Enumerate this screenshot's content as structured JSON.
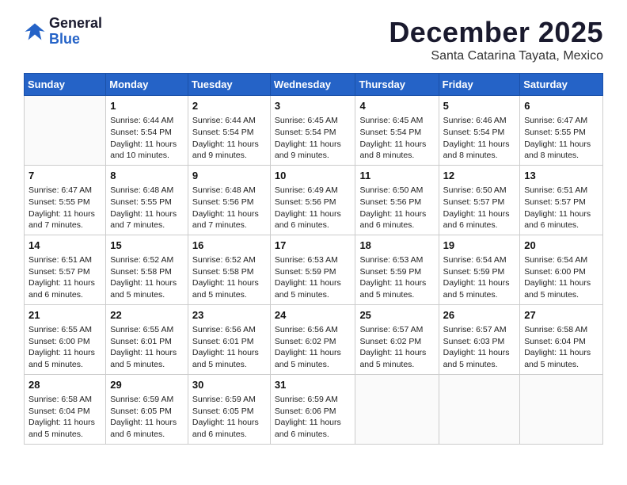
{
  "logo": {
    "line1": "General",
    "line2": "Blue"
  },
  "header": {
    "title": "December 2025",
    "subtitle": "Santa Catarina Tayata, Mexico"
  },
  "weekdays": [
    "Sunday",
    "Monday",
    "Tuesday",
    "Wednesday",
    "Thursday",
    "Friday",
    "Saturday"
  ],
  "weeks": [
    [
      {
        "day": "",
        "empty": true
      },
      {
        "day": "1",
        "sunrise": "6:44 AM",
        "sunset": "5:54 PM",
        "daylight": "11 hours and 10 minutes."
      },
      {
        "day": "2",
        "sunrise": "6:44 AM",
        "sunset": "5:54 PM",
        "daylight": "11 hours and 9 minutes."
      },
      {
        "day": "3",
        "sunrise": "6:45 AM",
        "sunset": "5:54 PM",
        "daylight": "11 hours and 9 minutes."
      },
      {
        "day": "4",
        "sunrise": "6:45 AM",
        "sunset": "5:54 PM",
        "daylight": "11 hours and 8 minutes."
      },
      {
        "day": "5",
        "sunrise": "6:46 AM",
        "sunset": "5:54 PM",
        "daylight": "11 hours and 8 minutes."
      },
      {
        "day": "6",
        "sunrise": "6:47 AM",
        "sunset": "5:55 PM",
        "daylight": "11 hours and 8 minutes."
      }
    ],
    [
      {
        "day": "7",
        "sunrise": "6:47 AM",
        "sunset": "5:55 PM",
        "daylight": "11 hours and 7 minutes."
      },
      {
        "day": "8",
        "sunrise": "6:48 AM",
        "sunset": "5:55 PM",
        "daylight": "11 hours and 7 minutes."
      },
      {
        "day": "9",
        "sunrise": "6:48 AM",
        "sunset": "5:56 PM",
        "daylight": "11 hours and 7 minutes."
      },
      {
        "day": "10",
        "sunrise": "6:49 AM",
        "sunset": "5:56 PM",
        "daylight": "11 hours and 6 minutes."
      },
      {
        "day": "11",
        "sunrise": "6:50 AM",
        "sunset": "5:56 PM",
        "daylight": "11 hours and 6 minutes."
      },
      {
        "day": "12",
        "sunrise": "6:50 AM",
        "sunset": "5:57 PM",
        "daylight": "11 hours and 6 minutes."
      },
      {
        "day": "13",
        "sunrise": "6:51 AM",
        "sunset": "5:57 PM",
        "daylight": "11 hours and 6 minutes."
      }
    ],
    [
      {
        "day": "14",
        "sunrise": "6:51 AM",
        "sunset": "5:57 PM",
        "daylight": "11 hours and 6 minutes."
      },
      {
        "day": "15",
        "sunrise": "6:52 AM",
        "sunset": "5:58 PM",
        "daylight": "11 hours and 5 minutes."
      },
      {
        "day": "16",
        "sunrise": "6:52 AM",
        "sunset": "5:58 PM",
        "daylight": "11 hours and 5 minutes."
      },
      {
        "day": "17",
        "sunrise": "6:53 AM",
        "sunset": "5:59 PM",
        "daylight": "11 hours and 5 minutes."
      },
      {
        "day": "18",
        "sunrise": "6:53 AM",
        "sunset": "5:59 PM",
        "daylight": "11 hours and 5 minutes."
      },
      {
        "day": "19",
        "sunrise": "6:54 AM",
        "sunset": "5:59 PM",
        "daylight": "11 hours and 5 minutes."
      },
      {
        "day": "20",
        "sunrise": "6:54 AM",
        "sunset": "6:00 PM",
        "daylight": "11 hours and 5 minutes."
      }
    ],
    [
      {
        "day": "21",
        "sunrise": "6:55 AM",
        "sunset": "6:00 PM",
        "daylight": "11 hours and 5 minutes."
      },
      {
        "day": "22",
        "sunrise": "6:55 AM",
        "sunset": "6:01 PM",
        "daylight": "11 hours and 5 minutes."
      },
      {
        "day": "23",
        "sunrise": "6:56 AM",
        "sunset": "6:01 PM",
        "daylight": "11 hours and 5 minutes."
      },
      {
        "day": "24",
        "sunrise": "6:56 AM",
        "sunset": "6:02 PM",
        "daylight": "11 hours and 5 minutes."
      },
      {
        "day": "25",
        "sunrise": "6:57 AM",
        "sunset": "6:02 PM",
        "daylight": "11 hours and 5 minutes."
      },
      {
        "day": "26",
        "sunrise": "6:57 AM",
        "sunset": "6:03 PM",
        "daylight": "11 hours and 5 minutes."
      },
      {
        "day": "27",
        "sunrise": "6:58 AM",
        "sunset": "6:04 PM",
        "daylight": "11 hours and 5 minutes."
      }
    ],
    [
      {
        "day": "28",
        "sunrise": "6:58 AM",
        "sunset": "6:04 PM",
        "daylight": "11 hours and 5 minutes."
      },
      {
        "day": "29",
        "sunrise": "6:59 AM",
        "sunset": "6:05 PM",
        "daylight": "11 hours and 6 minutes."
      },
      {
        "day": "30",
        "sunrise": "6:59 AM",
        "sunset": "6:05 PM",
        "daylight": "11 hours and 6 minutes."
      },
      {
        "day": "31",
        "sunrise": "6:59 AM",
        "sunset": "6:06 PM",
        "daylight": "11 hours and 6 minutes."
      },
      {
        "day": "",
        "empty": true
      },
      {
        "day": "",
        "empty": true
      },
      {
        "day": "",
        "empty": true
      }
    ]
  ],
  "labels": {
    "sunrise": "Sunrise:",
    "sunset": "Sunset:",
    "daylight": "Daylight:"
  }
}
